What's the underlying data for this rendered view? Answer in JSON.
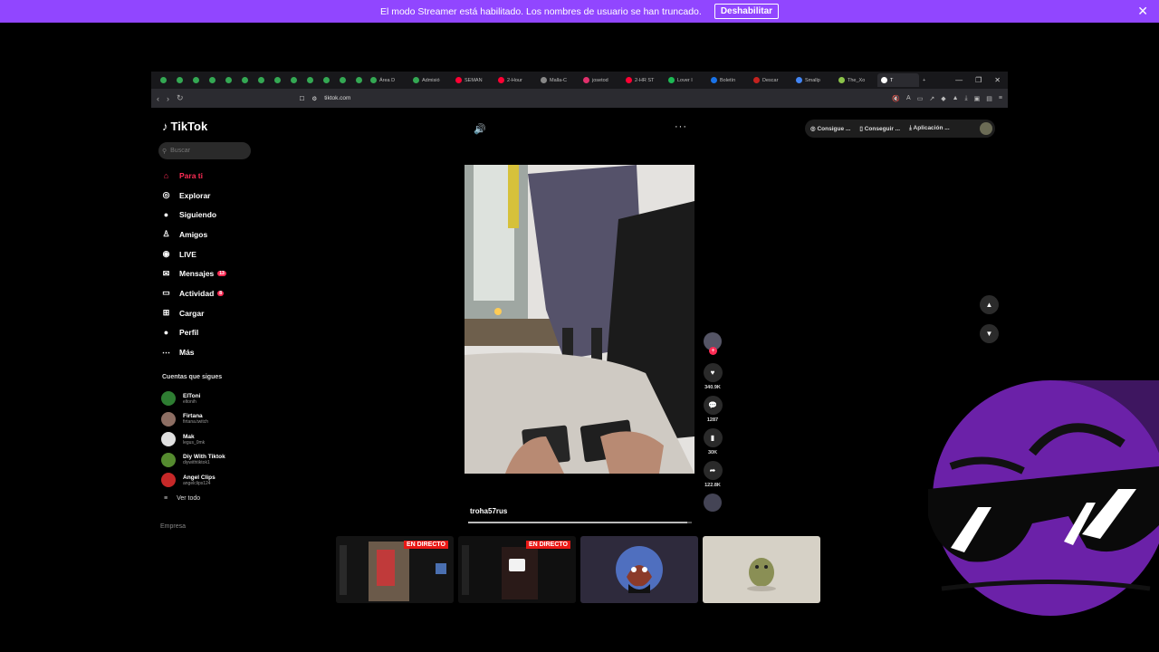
{
  "banner": {
    "message": "El modo Streamer está habilitado. Los nombres de usuario se han truncado.",
    "button": "Deshabilitar",
    "close": "✕"
  },
  "browser": {
    "tabs": [
      {
        "label": "",
        "color": "#34a853",
        "pinned": true
      },
      {
        "label": "",
        "color": "#34a853",
        "pinned": true
      },
      {
        "label": "",
        "color": "#34a853",
        "pinned": true
      },
      {
        "label": "",
        "color": "#34a853",
        "pinned": true
      },
      {
        "label": "",
        "color": "#34a853",
        "pinned": true
      },
      {
        "label": "",
        "color": "#34a853",
        "pinned": true
      },
      {
        "label": "",
        "color": "#34a853",
        "pinned": true
      },
      {
        "label": "",
        "color": "#34a853",
        "pinned": true
      },
      {
        "label": "",
        "color": "#34a853",
        "pinned": true
      },
      {
        "label": "",
        "color": "#34a853",
        "pinned": true
      },
      {
        "label": "",
        "color": "#34a853",
        "pinned": true
      },
      {
        "label": "",
        "color": "#34a853",
        "pinned": true
      },
      {
        "label": "",
        "color": "#34a853",
        "pinned": true
      },
      {
        "label": "Área D",
        "color": "#34a853",
        "pinned": false
      },
      {
        "label": "Admisió",
        "color": "#34a853",
        "pinned": false
      },
      {
        "label": "SEMAN",
        "color": "#ff0033",
        "pinned": false
      },
      {
        "label": "2-Hour",
        "color": "#ff0033",
        "pinned": false
      },
      {
        "label": "Malla-C",
        "color": "#888888",
        "pinned": false
      },
      {
        "label": "josetod",
        "color": "#e1306c",
        "pinned": false
      },
      {
        "label": "2-HR ST",
        "color": "#ff0033",
        "pinned": false
      },
      {
        "label": "Lover I",
        "color": "#1db954",
        "pinned": false
      },
      {
        "label": "Boletín",
        "color": "#1a73e8",
        "pinned": false
      },
      {
        "label": "Descar",
        "color": "#c5221f",
        "pinned": false
      },
      {
        "label": "Smallp",
        "color": "#4285f4",
        "pinned": false
      },
      {
        "label": "The_Xo",
        "color": "#8bc34a",
        "pinned": false
      },
      {
        "label": "T",
        "color": "#ffffff",
        "pinned": false,
        "active": true
      }
    ],
    "new_tab": "+",
    "url": "tiktok.com"
  },
  "tiktok": {
    "logo": "TikTok",
    "search_placeholder": "Buscar",
    "nav": [
      {
        "label": "Para ti",
        "icon": "home-icon",
        "active": true
      },
      {
        "label": "Explorar",
        "icon": "compass-icon"
      },
      {
        "label": "Siguiendo",
        "icon": "following-icon"
      },
      {
        "label": "Amigos",
        "icon": "friends-icon"
      },
      {
        "label": "LIVE",
        "icon": "live-icon"
      },
      {
        "label": "Mensajes",
        "icon": "messages-icon",
        "badge": "13"
      },
      {
        "label": "Actividad",
        "icon": "activity-icon",
        "badge": "8"
      },
      {
        "label": "Cargar",
        "icon": "upload-icon"
      },
      {
        "label": "Perfil",
        "icon": "profile-icon"
      },
      {
        "label": "Más",
        "icon": "more-icon"
      }
    ],
    "following_title": "Cuentas que sigues",
    "accounts": [
      {
        "name": "ElToni",
        "handle": "eltonih",
        "color": "#2e7d32"
      },
      {
        "name": "Firtana",
        "handle": "firtana.twitch",
        "color": "#8d6e63"
      },
      {
        "name": "Mak",
        "handle": "legus_0mk",
        "color": "#e0e0e0"
      },
      {
        "name": "Diy With Tiktok",
        "handle": "diywithtiktok1",
        "color": "#558b2f"
      },
      {
        "name": "Angel Clips",
        "handle": "angelclips124",
        "color": "#c62828"
      }
    ],
    "see_all": "Ver todo",
    "footer": "Empresa",
    "top_actions": [
      "Consigue ...",
      "Conseguir ...",
      "Aplicación ..."
    ],
    "video": {
      "username": "troha57rus",
      "likes": "340.9K",
      "comments": "1287",
      "saves": "30K",
      "shares": "122.8K",
      "progress": 0.98
    }
  },
  "streams": [
    {
      "live_label": "EN DIRECTO"
    },
    {
      "live_label": "EN DIRECTO"
    },
    {
      "live_label": ""
    },
    {
      "live_label": ""
    }
  ]
}
